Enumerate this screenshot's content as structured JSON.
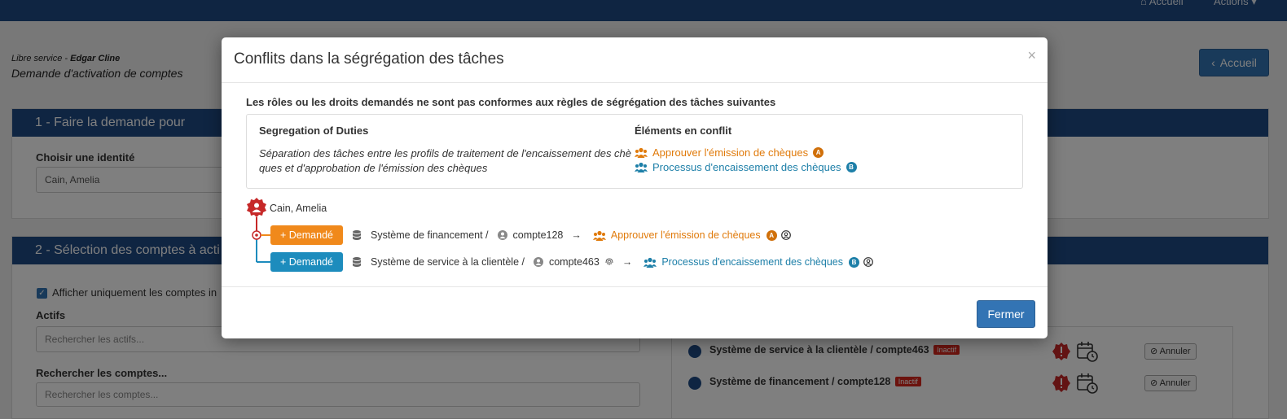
{
  "app": {
    "nav_home": "Accueil",
    "nav_actions": "Actions",
    "breadcrumb_prefix": "Libre service - ",
    "breadcrumb_user": "Edgar Cline",
    "page_title": "Demande d'activation de comptes",
    "home_button": "Accueil"
  },
  "section1": {
    "title": "1 - Faire la demande pour",
    "identity_label": "Choisir une identité",
    "identity_value": "Cain, Amelia"
  },
  "section2": {
    "title": "2 - Sélection des comptes à acti",
    "filter_checkbox_label": "Afficher uniquement les comptes in",
    "assets_label": "Actifs",
    "assets_placeholder": "Rechercher les actifs...",
    "accounts_label": "Rechercher les comptes...",
    "accounts_placeholder": "Rechercher les comptes...",
    "requests": [
      {
        "account": "Système de service à la clientèle / compte463",
        "status": "Inactif",
        "cancel": "Annuler"
      },
      {
        "account": "Système de financement / compte128",
        "status": "Inactif",
        "cancel": "Annuler"
      }
    ]
  },
  "modal": {
    "title": "Conflits dans la ségrégation des tâches",
    "close_symbol": "×",
    "intro": "Les rôles ou les droits demandés ne sont pas conformes aux règles de ségrégation des tâches suivantes",
    "sod_header": "Segregation of Duties",
    "conflict_header": "Éléments en conflit",
    "sod_description": "Séparation des tâches entre les profils de traitement de l'encaissement des chèques et d'approbation de l'émission des chèques",
    "conflicts": [
      {
        "label": "Approuver l'émission de chèques",
        "letter": "A",
        "color": "#e07a0a"
      },
      {
        "label": "Processus d'encaissement des chèques",
        "letter": "B",
        "color": "#1d7fa8"
      }
    ],
    "identity": "Cain, Amelia",
    "tree_rows": [
      {
        "button": "+ Demandé",
        "system": "Système de financement /",
        "account": "compte128",
        "role": "Approuver l'émission de chèques",
        "letter": "A"
      },
      {
        "button": "+ Demandé",
        "system": "Système de service à la clientèle /",
        "account": "compte463",
        "role": "Processus d'encaissement des chèques",
        "letter": "B"
      }
    ],
    "close_button": "Fermer"
  }
}
